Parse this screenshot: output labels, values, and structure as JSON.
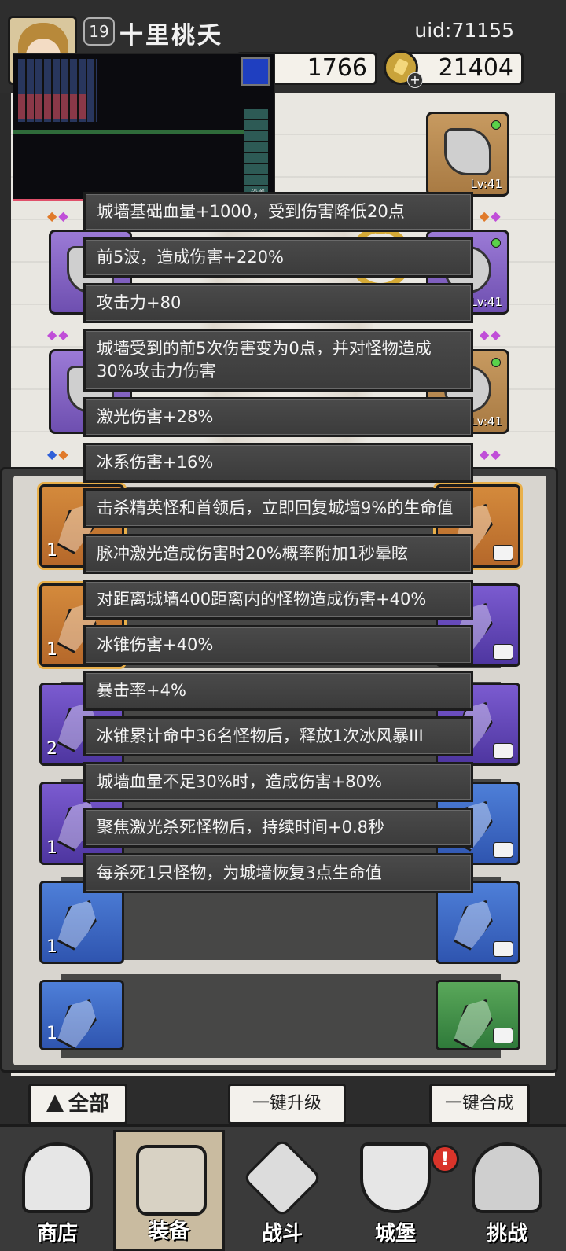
{
  "player": {
    "level": "19",
    "name": "十里桃夭",
    "uid": "uid:71155"
  },
  "resources": {
    "gems": "1766",
    "gold": "21404",
    "plus": "+"
  },
  "video_overlay": {
    "settings_label": "设置"
  },
  "equipment": {
    "level_label": "Lv:41"
  },
  "effects": [
    "城墙基础血量+1000，受到伤害降低20点",
    "前5波，造成伤害+220%",
    "攻击力+80",
    "城墙受到的前5次伤害变为0点，并对怪物造成30%攻击力伤害",
    "激光伤害+28%",
    "冰系伤害+16%",
    "击杀精英怪和首领后，立即回复城墙9%的生命值",
    "脉冲激光造成伤害时20%概率附加1秒晕眩",
    "对距离城墙400距离内的怪物造成伤害+40%",
    "冰锥伤害+40%",
    "暴击率+4%",
    "冰锥累计命中36名怪物后，释放1次冰风暴III",
    "城墙血量不足30%时，造成伤害+80%",
    "聚焦激光杀死怪物后，持续时间+0.8秒",
    "每杀死1只怪物，为城墙恢复3点生命值"
  ],
  "inventory": {
    "counts": [
      "1",
      "1",
      "2",
      "1",
      "1",
      "1"
    ]
  },
  "buttons": {
    "filter_all": "全部",
    "upgrade_all": "一键升级",
    "merge_all": "一键合成"
  },
  "alert_mark": "!",
  "nav": [
    {
      "label": "商店"
    },
    {
      "label": "装备"
    },
    {
      "label": "战斗"
    },
    {
      "label": "城堡"
    },
    {
      "label": "挑战"
    }
  ]
}
